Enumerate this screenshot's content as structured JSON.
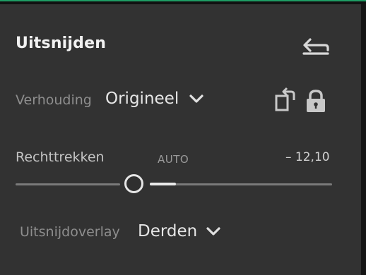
{
  "panel": {
    "title": "Uitsnijden",
    "reset_icon": "reset-arrow-icon"
  },
  "aspect": {
    "label": "Verhouding",
    "value": "Origineel",
    "rotate_icon": "rotate-orientation-icon",
    "lock_icon": "lock-icon"
  },
  "straighten": {
    "label": "Rechttrekken",
    "auto_label": "AUTO",
    "value": "– 12,10"
  },
  "overlay": {
    "label": "Uitsnijdoverlay",
    "value": "Derden"
  }
}
